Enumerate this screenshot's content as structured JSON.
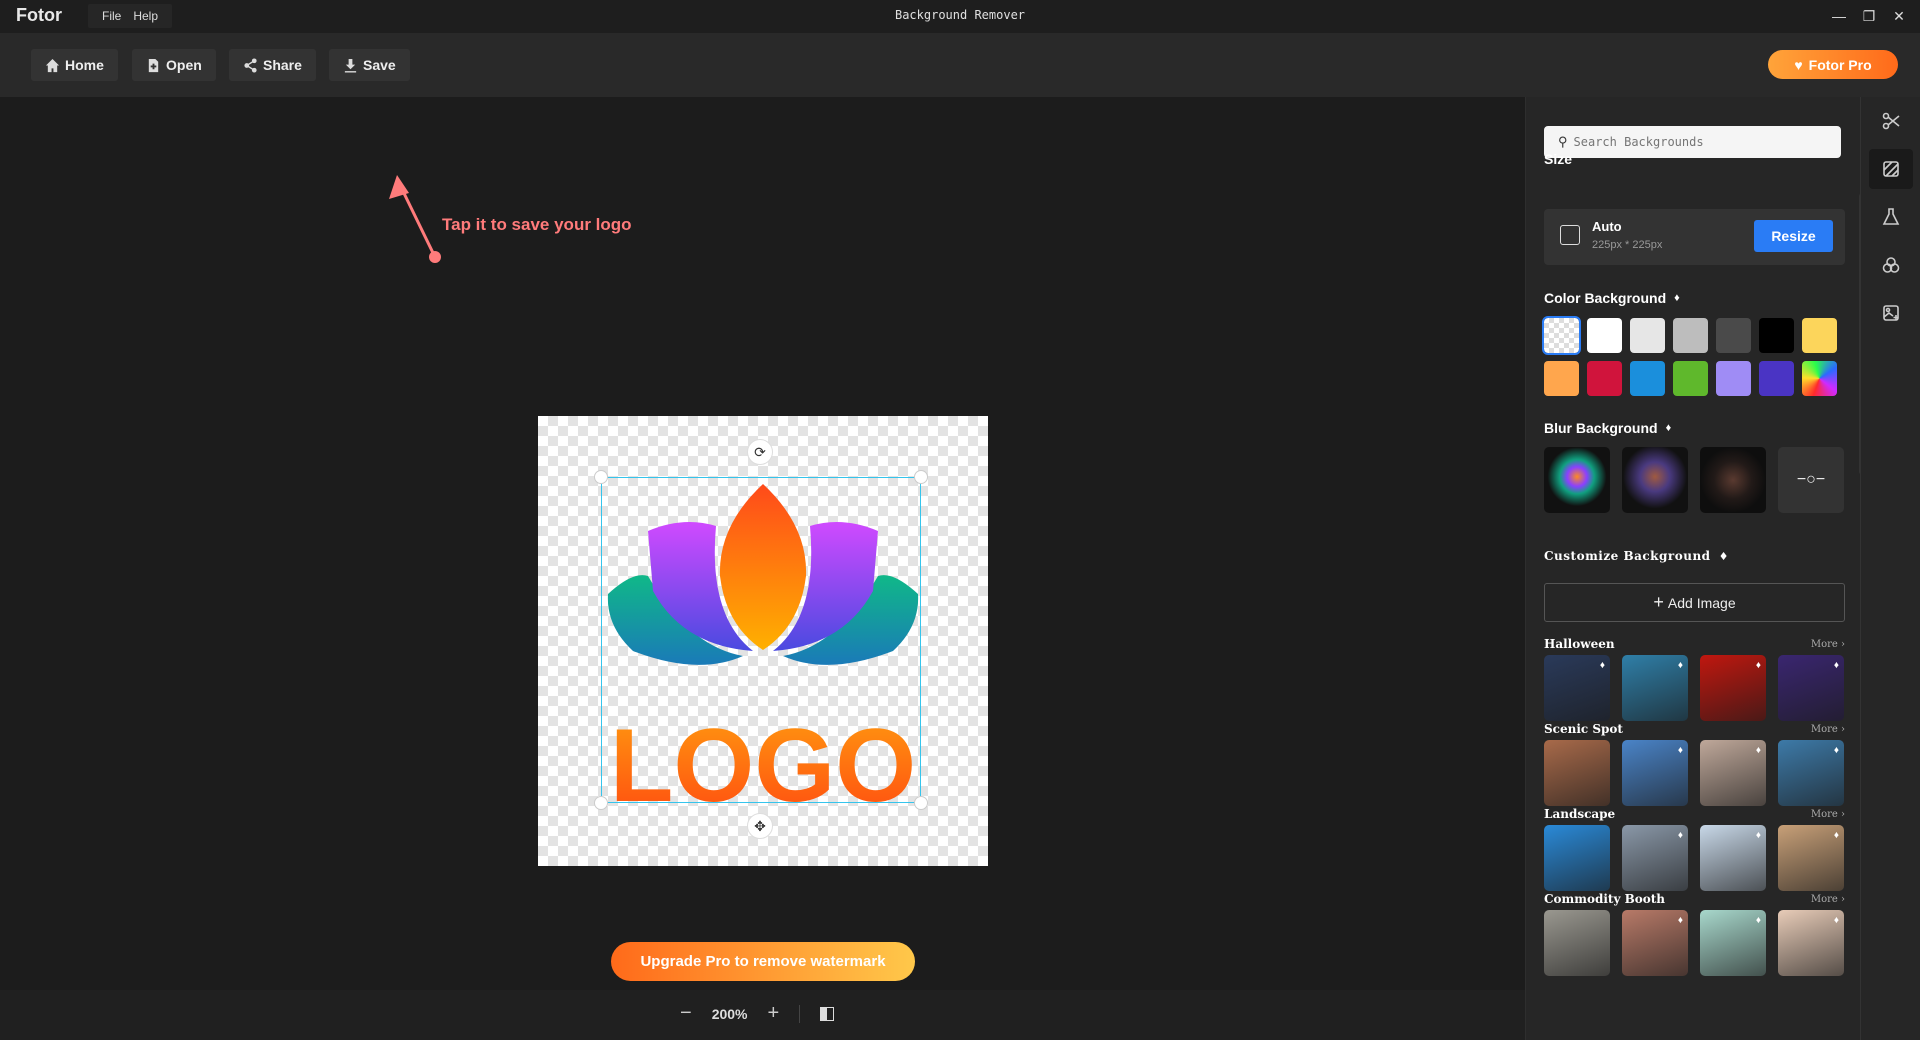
{
  "app": {
    "brand": "Fotor",
    "window_title": "Background Remover",
    "menu": [
      "File",
      "Help"
    ]
  },
  "toolbar": {
    "home": "Home",
    "open": "Open",
    "share": "Share",
    "save": "Save",
    "pro": "Fotor Pro"
  },
  "annotation": {
    "text": "Tap it to save your logo",
    "color": "#ff7b7b"
  },
  "canvas": {
    "logo_text": "LOGO",
    "upgrade_label": "Upgrade Pro to remove watermark"
  },
  "zoom": {
    "value": "200%",
    "minus": "−",
    "plus": "+"
  },
  "panel": {
    "search_placeholder": "Search Backgrounds",
    "size": {
      "title": "Size",
      "mode": "Auto",
      "dims": "225px * 225px",
      "resize": "Resize"
    },
    "color_bg": {
      "title": "Color Background",
      "colors": [
        "transparent",
        "#ffffff",
        "#e6e6e6",
        "#bdbdbd",
        "#4a4a4a",
        "#000000",
        "#fcd55b",
        "#ffa64d",
        "#d0143c",
        "#1b8fdc",
        "#5fb82c",
        "#9f8cf5",
        "#4a34c4",
        "rainbow"
      ]
    },
    "blur_bg": {
      "title": "Blur Background"
    },
    "custom_bg": {
      "title": "Customize Background",
      "add": "Add Image"
    },
    "categories": [
      {
        "name": "Halloween",
        "more": "More",
        "thumbs": [
          "#2a3a5a",
          "#2f7fa8",
          "#c0170f",
          "#3a2670"
        ]
      },
      {
        "name": "Scenic Spot",
        "more": "More",
        "thumbs": [
          "#a86a4a",
          "#4a84c8",
          "#bfa89a",
          "#3d7aa8"
        ]
      },
      {
        "name": "Landscape",
        "more": "More",
        "thumbs": [
          "#2a8ad8",
          "#8a98a8",
          "#c8d8e8",
          "#c8a078"
        ]
      },
      {
        "name": "Commodity Booth",
        "more": "More",
        "thumbs": [
          "#9a9890",
          "#b87a68",
          "#a8d8cc",
          "#e8ccb8"
        ]
      }
    ]
  },
  "rail": [
    "cutout-tool",
    "background-tool",
    "effects-tool",
    "filters-tool",
    "ai-image-tool"
  ]
}
